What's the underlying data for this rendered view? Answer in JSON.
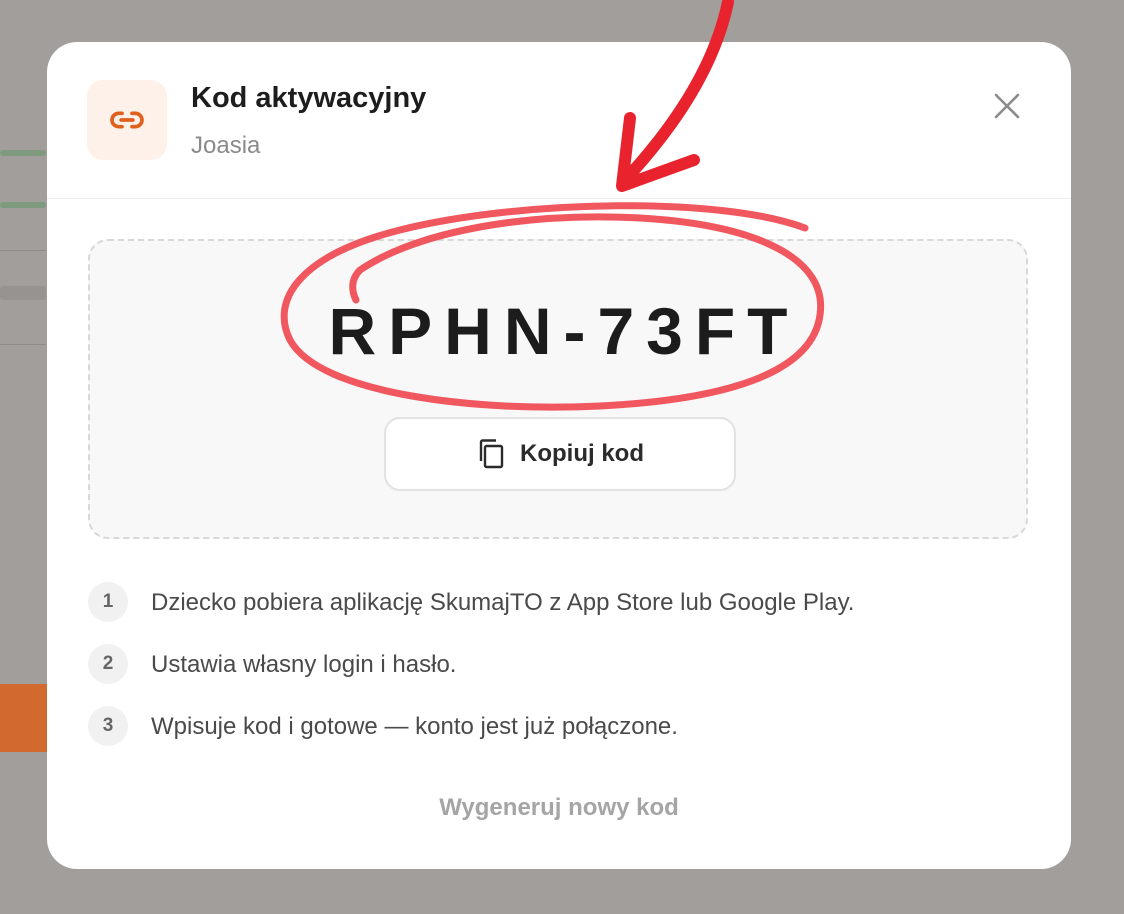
{
  "modal": {
    "title": "Kod aktywacyjny",
    "subtitle": "Joasia",
    "code": "RPHN-73FT",
    "copy_label": "Kopiuj kod",
    "steps": [
      {
        "num": "1",
        "text": "Dziecko pobiera aplikację SkumajTO z App Store lub Google Play."
      },
      {
        "num": "2",
        "text": "Ustawia własny login i hasło."
      },
      {
        "num": "3",
        "text": "Wpisuje kod i gotowe — konto jest już połączone."
      }
    ],
    "regenerate_label": "Wygeneruj nowy kod"
  },
  "icons": {
    "header": "link-icon",
    "close": "close-icon",
    "copy": "copy-icon"
  },
  "colors": {
    "accent": "#e0611c",
    "annotation": "#e8333f"
  }
}
